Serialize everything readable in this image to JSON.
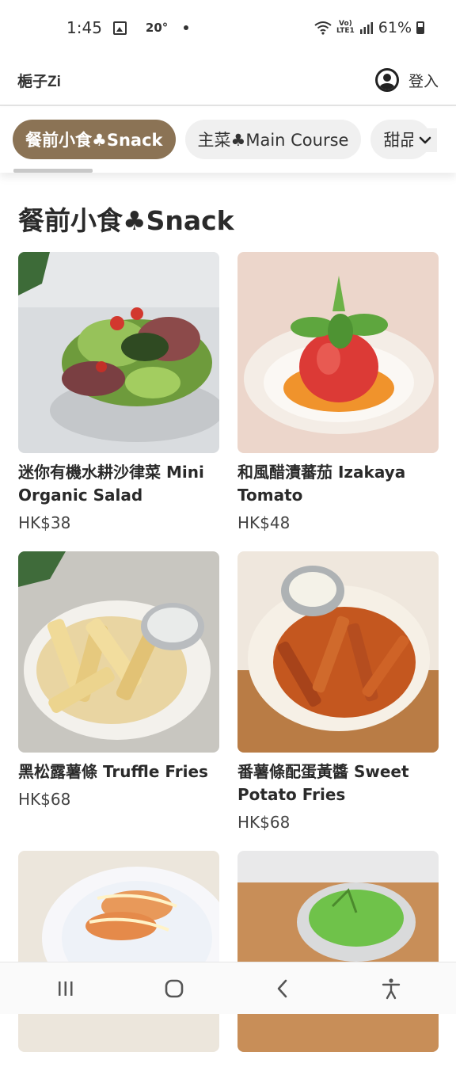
{
  "status": {
    "time": "1:45",
    "temp": "20°",
    "network": "LTE1",
    "volte": "Vo)",
    "battery": "61%"
  },
  "header": {
    "brand": "梔子Zi",
    "login_label": "登入"
  },
  "tabs": [
    {
      "label": "餐前小食♣Snack",
      "active": true
    },
    {
      "label": "主菜♣Main Course",
      "active": false
    },
    {
      "label": "甜品",
      "active": false
    }
  ],
  "section": {
    "title": "餐前小食♣Snack"
  },
  "items": [
    {
      "name": "迷你有機水耕沙律菜 Mini Organic Salad",
      "price": "HK$38"
    },
    {
      "name": "和風醋漬蕃茄 Izakaya Tomato",
      "price": "HK$48"
    },
    {
      "name": "黑松露薯條 Truffle Fries",
      "price": "HK$68"
    },
    {
      "name": "番薯條配蛋黃醬 Sweet Potato Fries",
      "price": "HK$68"
    }
  ],
  "icons": {
    "user": "user-circle-icon",
    "more": "chevron-down-icon",
    "nav": [
      "recents-icon",
      "home-icon",
      "back-icon",
      "accessibility-icon"
    ]
  },
  "colors": {
    "accent": "#8b7355"
  }
}
